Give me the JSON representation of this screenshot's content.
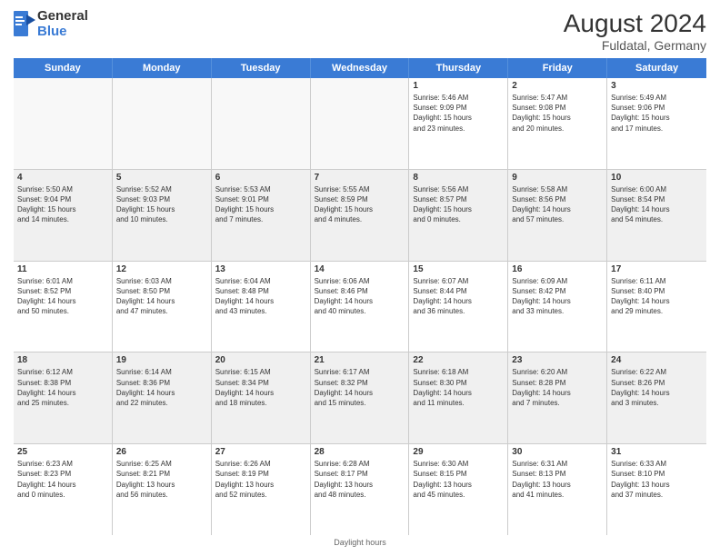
{
  "header": {
    "logo_line1": "General",
    "logo_line2": "Blue",
    "title": "August 2024",
    "subtitle": "Fuldatal, Germany"
  },
  "days_of_week": [
    "Sunday",
    "Monday",
    "Tuesday",
    "Wednesday",
    "Thursday",
    "Friday",
    "Saturday"
  ],
  "footer": "Daylight hours",
  "weeks": [
    [
      {
        "day": "",
        "info": ""
      },
      {
        "day": "",
        "info": ""
      },
      {
        "day": "",
        "info": ""
      },
      {
        "day": "",
        "info": ""
      },
      {
        "day": "1",
        "info": "Sunrise: 5:46 AM\nSunset: 9:09 PM\nDaylight: 15 hours\nand 23 minutes."
      },
      {
        "day": "2",
        "info": "Sunrise: 5:47 AM\nSunset: 9:08 PM\nDaylight: 15 hours\nand 20 minutes."
      },
      {
        "day": "3",
        "info": "Sunrise: 5:49 AM\nSunset: 9:06 PM\nDaylight: 15 hours\nand 17 minutes."
      }
    ],
    [
      {
        "day": "4",
        "info": "Sunrise: 5:50 AM\nSunset: 9:04 PM\nDaylight: 15 hours\nand 14 minutes."
      },
      {
        "day": "5",
        "info": "Sunrise: 5:52 AM\nSunset: 9:03 PM\nDaylight: 15 hours\nand 10 minutes."
      },
      {
        "day": "6",
        "info": "Sunrise: 5:53 AM\nSunset: 9:01 PM\nDaylight: 15 hours\nand 7 minutes."
      },
      {
        "day": "7",
        "info": "Sunrise: 5:55 AM\nSunset: 8:59 PM\nDaylight: 15 hours\nand 4 minutes."
      },
      {
        "day": "8",
        "info": "Sunrise: 5:56 AM\nSunset: 8:57 PM\nDaylight: 15 hours\nand 0 minutes."
      },
      {
        "day": "9",
        "info": "Sunrise: 5:58 AM\nSunset: 8:56 PM\nDaylight: 14 hours\nand 57 minutes."
      },
      {
        "day": "10",
        "info": "Sunrise: 6:00 AM\nSunset: 8:54 PM\nDaylight: 14 hours\nand 54 minutes."
      }
    ],
    [
      {
        "day": "11",
        "info": "Sunrise: 6:01 AM\nSunset: 8:52 PM\nDaylight: 14 hours\nand 50 minutes."
      },
      {
        "day": "12",
        "info": "Sunrise: 6:03 AM\nSunset: 8:50 PM\nDaylight: 14 hours\nand 47 minutes."
      },
      {
        "day": "13",
        "info": "Sunrise: 6:04 AM\nSunset: 8:48 PM\nDaylight: 14 hours\nand 43 minutes."
      },
      {
        "day": "14",
        "info": "Sunrise: 6:06 AM\nSunset: 8:46 PM\nDaylight: 14 hours\nand 40 minutes."
      },
      {
        "day": "15",
        "info": "Sunrise: 6:07 AM\nSunset: 8:44 PM\nDaylight: 14 hours\nand 36 minutes."
      },
      {
        "day": "16",
        "info": "Sunrise: 6:09 AM\nSunset: 8:42 PM\nDaylight: 14 hours\nand 33 minutes."
      },
      {
        "day": "17",
        "info": "Sunrise: 6:11 AM\nSunset: 8:40 PM\nDaylight: 14 hours\nand 29 minutes."
      }
    ],
    [
      {
        "day": "18",
        "info": "Sunrise: 6:12 AM\nSunset: 8:38 PM\nDaylight: 14 hours\nand 25 minutes."
      },
      {
        "day": "19",
        "info": "Sunrise: 6:14 AM\nSunset: 8:36 PM\nDaylight: 14 hours\nand 22 minutes."
      },
      {
        "day": "20",
        "info": "Sunrise: 6:15 AM\nSunset: 8:34 PM\nDaylight: 14 hours\nand 18 minutes."
      },
      {
        "day": "21",
        "info": "Sunrise: 6:17 AM\nSunset: 8:32 PM\nDaylight: 14 hours\nand 15 minutes."
      },
      {
        "day": "22",
        "info": "Sunrise: 6:18 AM\nSunset: 8:30 PM\nDaylight: 14 hours\nand 11 minutes."
      },
      {
        "day": "23",
        "info": "Sunrise: 6:20 AM\nSunset: 8:28 PM\nDaylight: 14 hours\nand 7 minutes."
      },
      {
        "day": "24",
        "info": "Sunrise: 6:22 AM\nSunset: 8:26 PM\nDaylight: 14 hours\nand 3 minutes."
      }
    ],
    [
      {
        "day": "25",
        "info": "Sunrise: 6:23 AM\nSunset: 8:23 PM\nDaylight: 14 hours\nand 0 minutes."
      },
      {
        "day": "26",
        "info": "Sunrise: 6:25 AM\nSunset: 8:21 PM\nDaylight: 13 hours\nand 56 minutes."
      },
      {
        "day": "27",
        "info": "Sunrise: 6:26 AM\nSunset: 8:19 PM\nDaylight: 13 hours\nand 52 minutes."
      },
      {
        "day": "28",
        "info": "Sunrise: 6:28 AM\nSunset: 8:17 PM\nDaylight: 13 hours\nand 48 minutes."
      },
      {
        "day": "29",
        "info": "Sunrise: 6:30 AM\nSunset: 8:15 PM\nDaylight: 13 hours\nand 45 minutes."
      },
      {
        "day": "30",
        "info": "Sunrise: 6:31 AM\nSunset: 8:13 PM\nDaylight: 13 hours\nand 41 minutes."
      },
      {
        "day": "31",
        "info": "Sunrise: 6:33 AM\nSunset: 8:10 PM\nDaylight: 13 hours\nand 37 minutes."
      }
    ]
  ]
}
